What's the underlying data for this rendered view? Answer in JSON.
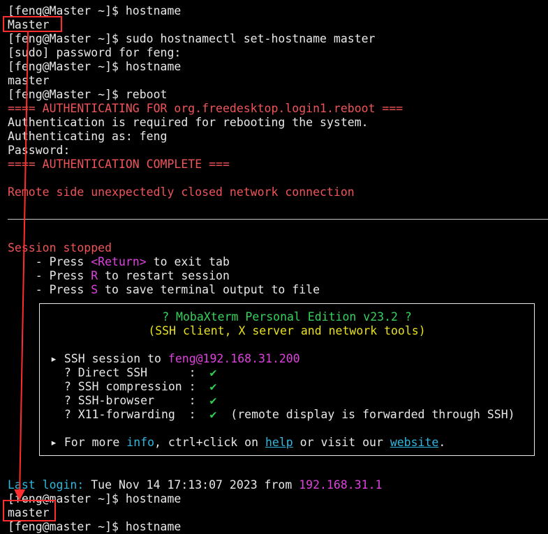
{
  "terminal": {
    "lines": [
      "[feng@Master ~]$ hostname",
      "Master",
      "[feng@Master ~]$ sudo hostnamectl set-hostname master",
      "[sudo] password for feng:",
      "[feng@Master ~]$ hostname",
      "master",
      "[feng@Master ~]$ reboot",
      "==== AUTHENTICATING FOR org.freedesktop.login1.reboot ===",
      "Authentication is required for rebooting the system.",
      "Authenticating as: feng",
      "Password:",
      "==== AUTHENTICATION COMPLETE ===",
      "Remote side unexpectedly closed network connection",
      "Session stopped"
    ],
    "press": {
      "prefix": "    - Press ",
      "return_key": "<Return>",
      "return_text": " to exit tab",
      "r_key": "R",
      "r_text": " to restart session",
      "s_key": "S",
      "s_text": " to save terminal output to file"
    },
    "panel": {
      "title": "? MobaXterm Personal Edition v23.2 ?",
      "subtitle": "(SSH client, X server and network tools)",
      "ssh_prefix": "▸ SSH session to ",
      "ssh_target": "feng@192.168.31.200",
      "features": [
        {
          "label": "  ? Direct SSH      :  ",
          "check": "✔",
          "note": ""
        },
        {
          "label": "  ? SSH compression :  ",
          "check": "✔",
          "note": ""
        },
        {
          "label": "  ? SSH-browser     :  ",
          "check": "✔",
          "note": ""
        },
        {
          "label": "  ? X11-forwarding  :  ",
          "check": "✔",
          "note": "  (remote display is forwarded through SSH)"
        }
      ],
      "more_prefix": "▸ For more ",
      "more_info": "info",
      "more_mid": ", ctrl+click on ",
      "more_help": "help",
      "more_or": " or visit our ",
      "more_website": "website",
      "more_end": "."
    },
    "last_login": {
      "label": "Last login:",
      "text": " Tue Nov 14 17:13:07 2023 from ",
      "ip": "192.168.31.1"
    },
    "tail": [
      "[feng@master ~]$ hostname",
      "master",
      "[feng@master ~]$ hostname"
    ]
  },
  "colors": {
    "background": "#000000",
    "foreground": "#e8e8e8",
    "red": "#f0545a",
    "magenta": "#e040e0",
    "cyan": "#2fb8e0",
    "yellow": "#e8e020",
    "annotation": "#ff2e2e"
  }
}
